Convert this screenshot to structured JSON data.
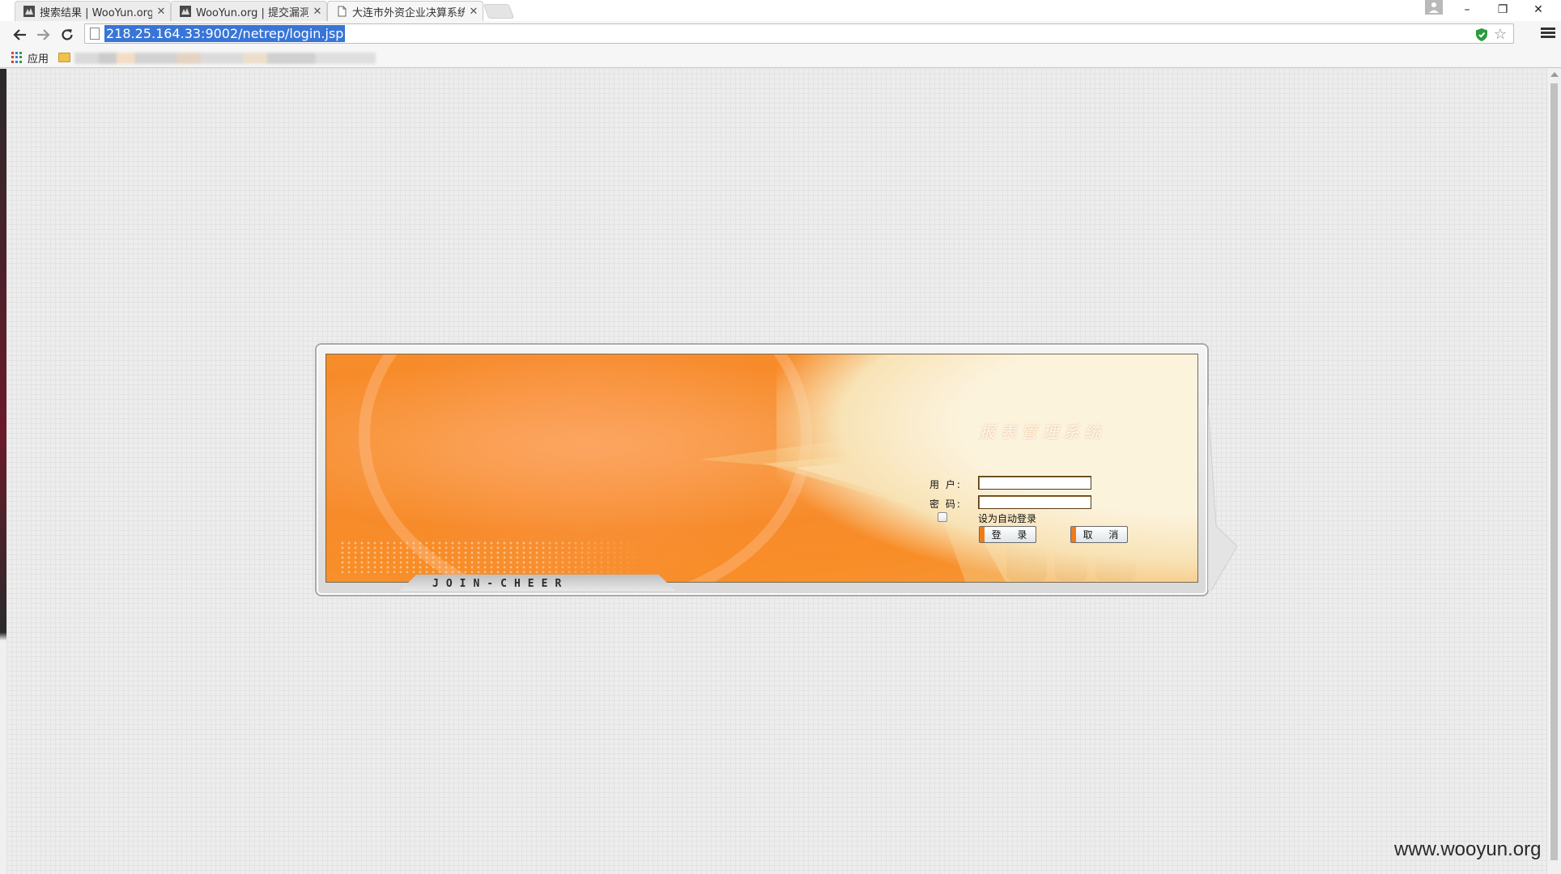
{
  "browser": {
    "tabs": [
      {
        "title": "搜索结果 | WooYun.org",
        "active": false,
        "favicon": "wooyun-icon"
      },
      {
        "title": "WooYun.org | 提交漏洞",
        "active": false,
        "favicon": "wooyun-icon"
      },
      {
        "title": "大连市外资企业决算系统",
        "active": true,
        "favicon": "page-icon"
      }
    ],
    "url": "218.25.164.33:9002/netrep/login.jsp",
    "bookmarks": {
      "apps_label": "应用"
    },
    "window_controls": {
      "minimize": "–",
      "restore": "❐",
      "close": "✕"
    }
  },
  "login": {
    "system_title": "报表管理系统",
    "user_label": "用  户:",
    "user_value": "",
    "password_label": "密  码:",
    "password_value": "",
    "auto_login_label": "设为自动登录",
    "auto_login_checked": false,
    "login_button": "登 录",
    "cancel_button": "取 消",
    "brand": "JOIN-CHEER"
  },
  "watermark": "www.wooyun.org",
  "colors": {
    "banner_orange": "#f78b2a",
    "banner_cream": "#fcf3dd",
    "url_highlight": "#3875d7",
    "button_accent": "#ef7b1c"
  }
}
